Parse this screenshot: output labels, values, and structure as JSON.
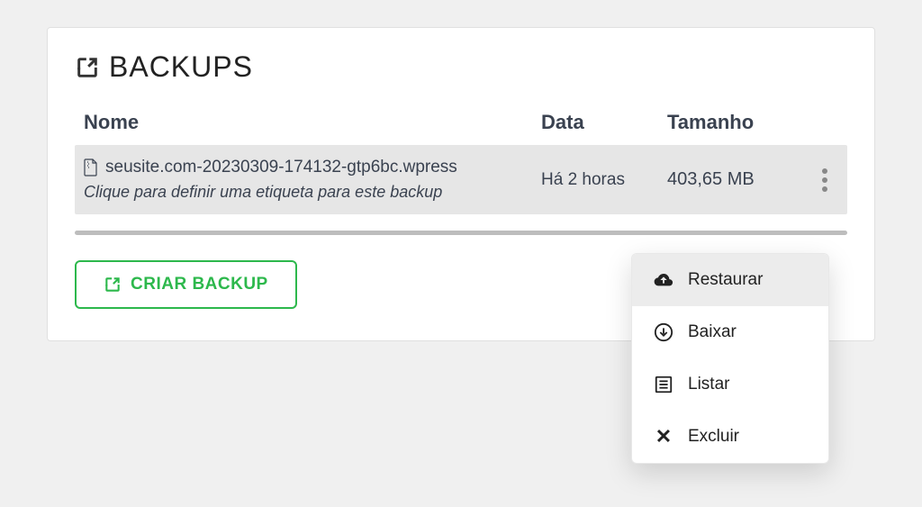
{
  "header": {
    "title": "BACKUPS"
  },
  "table": {
    "columns": {
      "name": "Nome",
      "date": "Data",
      "size": "Tamanho"
    },
    "rows": [
      {
        "filename": "seusite.com-20230309-174132-gtp6bc.wpress",
        "hint": "Clique para definir uma etiqueta para este backup",
        "date": "Há 2 horas",
        "size": "403,65 MB"
      }
    ]
  },
  "create_button": "CRIAR BACKUP",
  "dropdown": {
    "restore": "Restaurar",
    "download": "Baixar",
    "list": "Listar",
    "delete": "Excluir"
  }
}
